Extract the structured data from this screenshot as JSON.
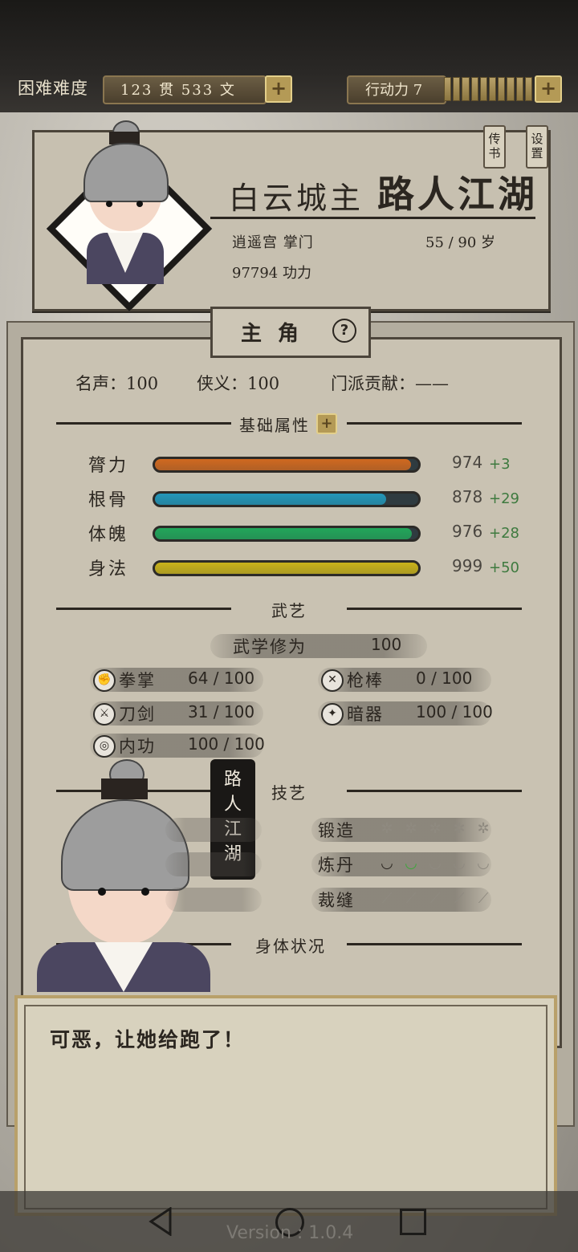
{
  "topbar": {
    "difficulty": "困难难度",
    "money": "123 贯 533 文",
    "action_points": "行动力 7",
    "action_max_segments": 10,
    "action_filled_segments": 10
  },
  "hero": {
    "title": "白云城主",
    "name": "路人江湖",
    "faction": "逍遥宫 掌门",
    "age": "55 / 90 岁",
    "power": "97794 功力"
  },
  "side_tags": {
    "letter": "传书",
    "settings": "设置"
  },
  "tab": {
    "label": "主角",
    "help": "?"
  },
  "reputation": {
    "fame": "名声：100",
    "chivalry": "侠义：100",
    "contribution": "门派贡献：——"
  },
  "sections": {
    "attributes": "基础属性",
    "martial": "武艺",
    "crafts": "技艺",
    "body": "身体状况"
  },
  "attributes": [
    {
      "name": "膂力",
      "value": "974",
      "bonus": "+3",
      "fill": 0.974,
      "color": "#d0691f"
    },
    {
      "name": "根骨",
      "value": "878",
      "bonus": "+29",
      "fill": 0.878,
      "color": "#2396b8"
    },
    {
      "name": "体魄",
      "value": "976",
      "bonus": "+28",
      "fill": 0.976,
      "color": "#22a65a"
    },
    {
      "name": "身法",
      "value": "999",
      "bonus": "+50",
      "fill": 0.999,
      "color": "#c9b21a"
    }
  ],
  "martial": {
    "cultivation_label": "武学修为",
    "cultivation_value": "100",
    "skills": [
      {
        "label": "拳掌",
        "value": "64 / 100",
        "icon": "fist-icon"
      },
      {
        "label": "枪棒",
        "value": "0 / 100",
        "icon": "spear-icon"
      },
      {
        "label": "刀剑",
        "value": "31 / 100",
        "icon": "sword-icon"
      },
      {
        "label": "暗器",
        "value": "100 / 100",
        "icon": "dart-icon"
      },
      {
        "label": "内功",
        "value": "100 / 100",
        "icon": "inner-power-icon"
      }
    ]
  },
  "crafts": [
    {
      "label": "锻造",
      "level": 0,
      "max": 5,
      "icon": "gear-icon"
    },
    {
      "label": "炼丹",
      "level": 2,
      "max": 5,
      "icon": "bowl-icon"
    },
    {
      "label": "裁缝",
      "level": 0,
      "max": 5,
      "icon": "needle-icon"
    }
  ],
  "speaker": {
    "name_vertical": [
      "路",
      "人",
      "江",
      "湖"
    ]
  },
  "dialog": {
    "text": "可恶，让她给跑了！"
  },
  "footer": {
    "version": "Version : 1.0.4"
  }
}
